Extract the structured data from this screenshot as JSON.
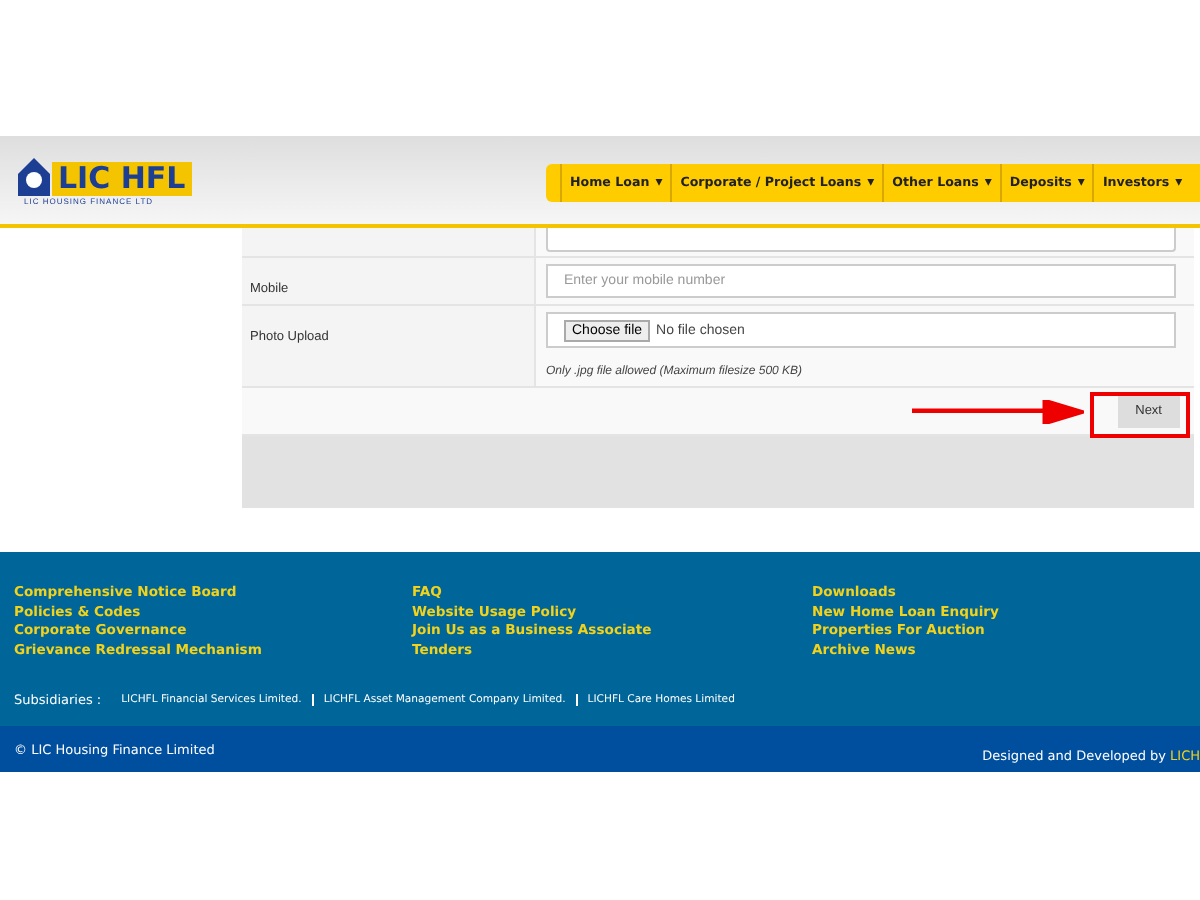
{
  "header": {
    "logo": {
      "title": "LIC HFL",
      "subtitle": "LIC HOUSING FINANCE LTD"
    },
    "nav": [
      {
        "label": "Home Loan",
        "caret": "▾"
      },
      {
        "label": "Corporate / Project Loans",
        "caret": "▾"
      },
      {
        "label": "Other Loans",
        "caret": "▾"
      },
      {
        "label": "Deposits",
        "caret": "▾"
      },
      {
        "label": "Investors",
        "caret": "▾"
      }
    ]
  },
  "form": {
    "rows": [
      {
        "kind": "textarea",
        "label": ""
      },
      {
        "kind": "text",
        "label": "Mobile",
        "placeholder": "Enter your mobile number"
      },
      {
        "kind": "file",
        "label": "Photo Upload",
        "button": "Choose file",
        "value": "No file chosen",
        "hint": "Only .jpg file allowed (Maximum filesize 500 KB)"
      }
    ],
    "next_button": "Next"
  },
  "footer": {
    "columns": [
      [
        "Comprehensive Notice Board",
        "Policies & Codes",
        "Corporate Governance",
        "Grievance Redressal Mechanism"
      ],
      [
        "FAQ",
        "Website Usage Policy",
        "Join Us as a Business Associate",
        "Tenders"
      ],
      [
        "Downloads",
        "New Home Loan Enquiry",
        "Properties For Auction",
        "Archive News"
      ]
    ],
    "subsidiaries_label": "Subsidiaries :",
    "subsidiaries": [
      "LICHFL Financial Services Limited.",
      "LICHFL Asset Management Company Limited.",
      "LICHFL Care Homes Limited"
    ]
  },
  "bottom_bar": {
    "copyright": "© LIC Housing Finance Limited",
    "credit": "Designed and Developed by",
    "credit_link": "LICH"
  }
}
